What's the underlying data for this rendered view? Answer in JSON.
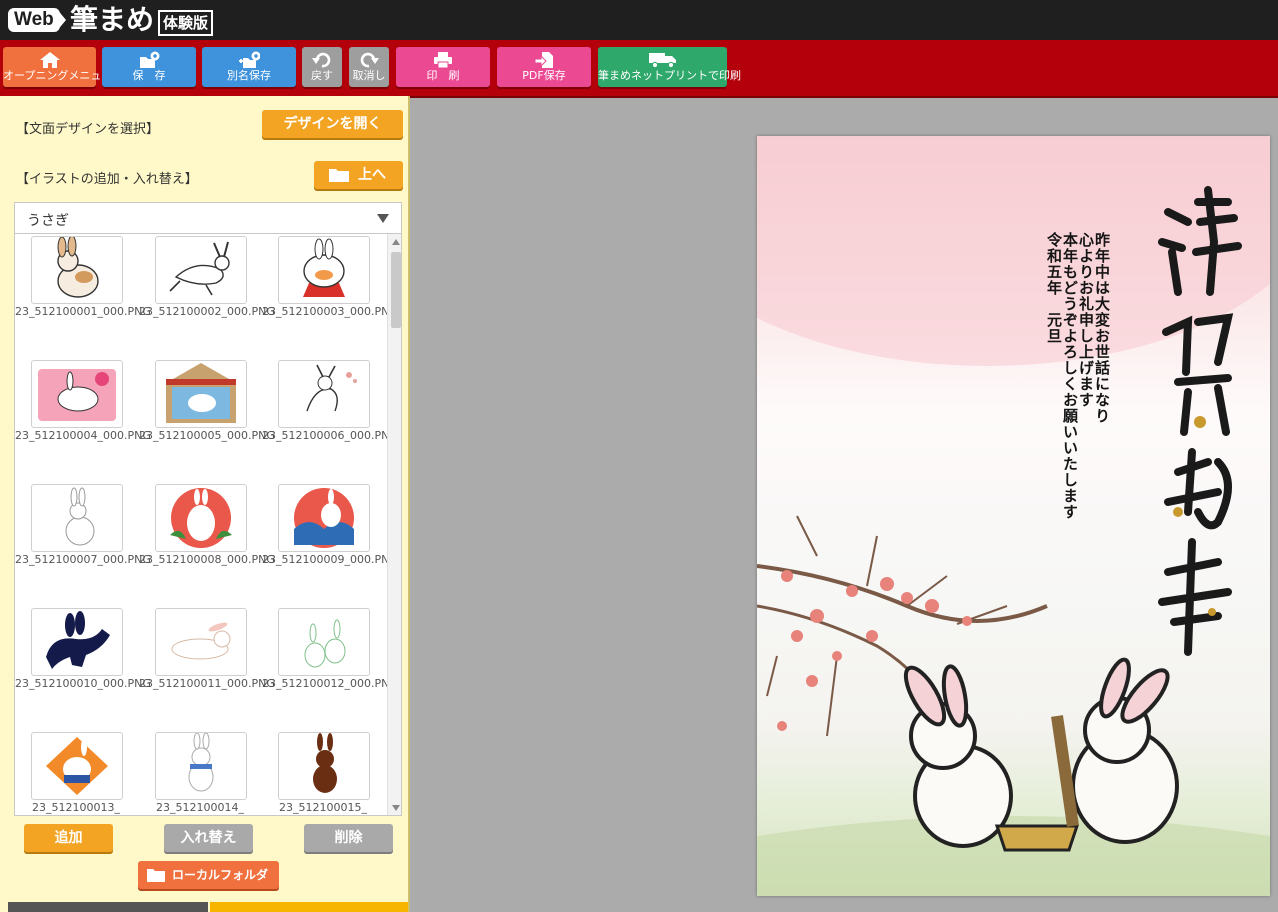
{
  "header": {
    "logo_web": "Web",
    "app_name": "筆まめ",
    "edition": "体験版"
  },
  "toolbar": {
    "buttons": [
      {
        "label": "オープニングメニュー",
        "icon": "home-icon",
        "color": "#f0703e"
      },
      {
        "label": "保　存",
        "icon": "save-icon",
        "color": "#3f93dc"
      },
      {
        "label": "別名保存",
        "icon": "save-as-icon",
        "color": "#3f93dc"
      },
      {
        "label": "戻す",
        "icon": "undo-icon",
        "color": "#9e9e9e"
      },
      {
        "label": "取消し",
        "icon": "redo-icon",
        "color": "#9e9e9e"
      },
      {
        "label": "印　刷",
        "icon": "print-icon",
        "color": "#eb4a93"
      },
      {
        "label": "PDF保存",
        "icon": "pdf-export-icon",
        "color": "#eb4a93"
      },
      {
        "label": "筆まめネットプリントで印刷",
        "icon": "truck-icon",
        "color": "#2fa86b"
      }
    ]
  },
  "left_panel": {
    "design_section_label": "【文面デザインを選択】",
    "open_design_button": "デザインを開く",
    "illust_section_label": "【イラストの追加・入れ替え】",
    "up_button": "上へ",
    "category_select": "うさぎ",
    "illustrations": [
      {
        "caption": "23_512100001_000.PNG"
      },
      {
        "caption": "23_512100002_000.PNG"
      },
      {
        "caption": "23_512100003_000.PNG"
      },
      {
        "caption": "23_512100004_000.PNG"
      },
      {
        "caption": "23_512100005_000.PNG"
      },
      {
        "caption": "23_512100006_000.PNG"
      },
      {
        "caption": "23_512100007_000.PNG"
      },
      {
        "caption": "23_512100008_000.PNG"
      },
      {
        "caption": "23_512100009_000.PNG"
      },
      {
        "caption": "23_512100010_000.PNG"
      },
      {
        "caption": "23_512100011_000.PNG"
      },
      {
        "caption": "23_512100012_000.PNG"
      },
      {
        "caption": "23_512100013_"
      },
      {
        "caption": "23_512100014_"
      },
      {
        "caption": "23_512100015_"
      }
    ],
    "add_button": "追加",
    "replace_button": "入れ替え",
    "delete_button": "削除",
    "local_folder_button": "ローカルフォルダ"
  },
  "card": {
    "greeting_lines": [
      "昨年中は大変お世話になり",
      "心よりお礼申し上げます",
      "本年もどうぞよろしくお願いいたします",
      "令和五年　元旦"
    ]
  }
}
